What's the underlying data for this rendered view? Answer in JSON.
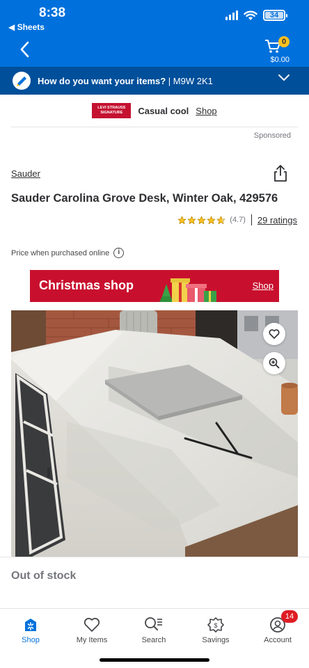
{
  "status_bar": {
    "time": "8:38",
    "back_app": "◀ Sheets",
    "battery": "34"
  },
  "header": {
    "back_icon": "chevron-left-icon",
    "cart": {
      "icon": "cart-icon",
      "count": "0",
      "total": "$0.00"
    },
    "delivery": {
      "question": "How do you want your items?",
      "separator": " | ",
      "postal_code": "M9W 2K1",
      "icon": "truck-icon"
    }
  },
  "sponsor_banner": {
    "logo_text": "LEVI STRAUSS SIGNATURE",
    "tagline": "Casual cool",
    "link": "Shop",
    "sponsored": "Sponsored"
  },
  "product": {
    "brand": "Sauder",
    "title": "Sauder Carolina Grove Desk, Winter Oak, 429576",
    "rating": 4.7,
    "rating_text": "(4.7)",
    "ratings_count": "29 ratings",
    "price_note": "Price when purchased online",
    "availability": "Out of stock"
  },
  "promo_banner": {
    "title": "Christmas shop",
    "link": "Shop",
    "color": "#c8102e"
  },
  "bottom_nav": {
    "items": [
      {
        "label": "Shop",
        "icon": "spark-icon",
        "active": true
      },
      {
        "label": "My Items",
        "icon": "heart-icon"
      },
      {
        "label": "Search",
        "icon": "search-icon"
      },
      {
        "label": "Savings",
        "icon": "savings-icon"
      },
      {
        "label": "Account",
        "icon": "account-icon",
        "badge": "14"
      }
    ]
  },
  "colors": {
    "brand_blue": "#0071dc",
    "delivery_bar": "#004f9a",
    "star": "#ffc220",
    "badge_red": "#de1c24"
  }
}
